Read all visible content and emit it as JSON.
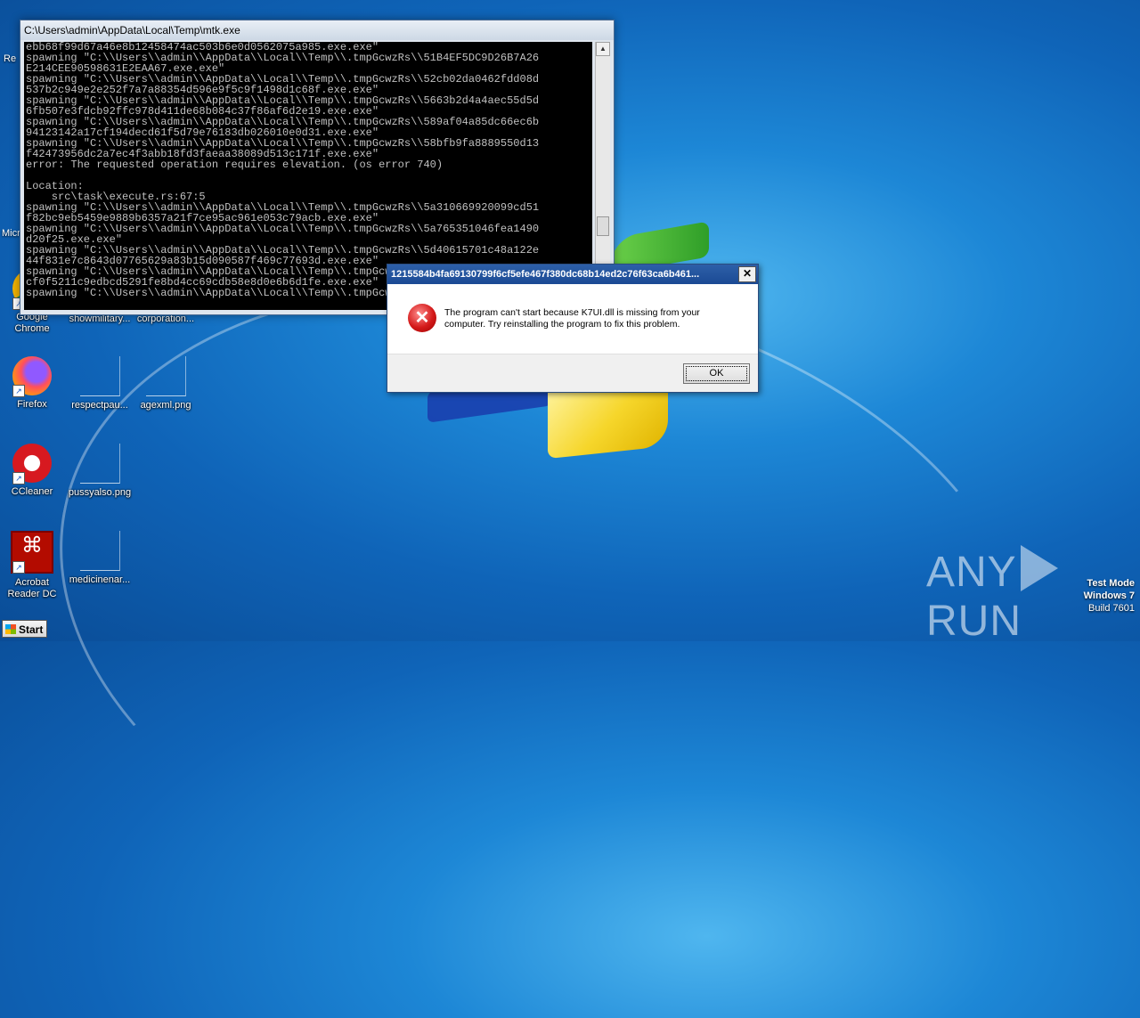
{
  "desktop": {
    "icons": [
      {
        "label": "Re"
      },
      {
        "label": "Micr"
      },
      {
        "label": "Google Chrome"
      },
      {
        "label": "showmilitary..."
      },
      {
        "label": "corporation..."
      },
      {
        "label": "Firefox"
      },
      {
        "label": "respectpau..."
      },
      {
        "label": "agexml.png"
      },
      {
        "label": "CCleaner"
      },
      {
        "label": "pussyalso.png"
      },
      {
        "label": "Acrobat Reader DC"
      },
      {
        "label": "medicinenar..."
      }
    ]
  },
  "console": {
    "title": "C:\\Users\\admin\\AppData\\Local\\Temp\\mtk.exe",
    "lines": [
      "ebb68f99d67a46e8b12458474ac503b6e0d0562075a985.exe.exe\"",
      "spawning \"C:\\\\Users\\\\admin\\\\AppData\\\\Local\\\\Temp\\\\.tmpGcwzRs\\\\51B4EF5DC9D26B7A26",
      "E214CEE90598631E2EAA67.exe.exe\"",
      "spawning \"C:\\\\Users\\\\admin\\\\AppData\\\\Local\\\\Temp\\\\.tmpGcwzRs\\\\52cb02da0462fdd08d",
      "537b2c949e2e252f7a7a88354d596e9f5c9f1498d1c68f.exe.exe\"",
      "spawning \"C:\\\\Users\\\\admin\\\\AppData\\\\Local\\\\Temp\\\\.tmpGcwzRs\\\\5663b2d4a4aec55d5d",
      "6fb507e3fdcb92ffc978d411de68b084c37f86af6d2e19.exe.exe\"",
      "spawning \"C:\\\\Users\\\\admin\\\\AppData\\\\Local\\\\Temp\\\\.tmpGcwzRs\\\\589af04a85dc66ec6b",
      "94123142a17cf194decd61f5d79e76183db026010e0d31.exe.exe\"",
      "spawning \"C:\\\\Users\\\\admin\\\\AppData\\\\Local\\\\Temp\\\\.tmpGcwzRs\\\\58bfb9fa8889550d13",
      "f42473956dc2a7ec4f3abb18fd3faeaa38089d513c171f.exe.exe\"",
      "error: The requested operation requires elevation. (os error 740)",
      "",
      "Location:",
      "    src\\task\\execute.rs:67:5",
      "spawning \"C:\\\\Users\\\\admin\\\\AppData\\\\Local\\\\Temp\\\\.tmpGcwzRs\\\\5a310669920099cd51",
      "f82bc9eb5459e9889b6357a21f7ce95ac961e053c79acb.exe.exe\"",
      "spawning \"C:\\\\Users\\\\admin\\\\AppData\\\\Local\\\\Temp\\\\.tmpGcwzRs\\\\5a765351046fea1490",
      "d20f25.exe.exe\"",
      "spawning \"C:\\\\Users\\\\admin\\\\AppData\\\\Local\\\\Temp\\\\.tmpGcwzRs\\\\5d40615701c48a122e",
      "44f831e7c8643d07765629a83b15d090587f469c77693d.exe.exe\"",
      "spawning \"C:\\\\Users\\\\admin\\\\AppData\\\\Local\\\\Temp\\\\.tmpGcwzRs\\\\",
      "cf0f5211c9edbcd5291fe8bd4cc69cdb58e8d0e6b6d1fe.exe.exe\"",
      "spawning \"C:\\\\Users\\\\admin\\\\AppData\\\\Local\\\\Temp\\\\.tmpGcwzRs\\\\"
    ]
  },
  "dialog": {
    "title": "1215584b4fa69130799f6cf5efe467f380dc68b14ed2c76f63ca6b461...",
    "close_label": "✕",
    "message": "The program can't start because K7UI.dll is missing from your computer. Try reinstalling the program to fix this problem.",
    "ok_label": "OK"
  },
  "watermark": {
    "left": "ANY",
    "right": "RUN"
  },
  "build_info": {
    "line1": "Test Mode",
    "line2": "Windows 7",
    "line3": "Build 7601"
  },
  "taskbar": {
    "start_label": "Start"
  }
}
